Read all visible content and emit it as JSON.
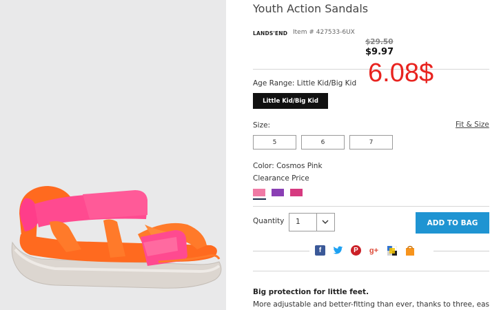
{
  "product": {
    "title": "Youth Action Sandals",
    "brand": "LANDS'END",
    "item_number": "Item # 427533-6UX",
    "price_original": "$29.50",
    "price_sale": "$9.97",
    "annotation": "6.08$"
  },
  "age_range": {
    "label": "Age Range: Little Kid/Big Kid",
    "selected": "Little Kid/Big Kid"
  },
  "size": {
    "label": "Size:",
    "fit_link": "Fit & Size",
    "options": [
      "5",
      "6",
      "7"
    ]
  },
  "color": {
    "label": "Color: Cosmos Pink",
    "price_note": "Clearance Price",
    "swatches": [
      "#f07aa5",
      "#8a3fb4",
      "#d63a80"
    ]
  },
  "quantity": {
    "label": "Quantity",
    "value": "1"
  },
  "add_to_bag": "ADD TO BAG",
  "share_icons": [
    "facebook-icon",
    "twitter-icon",
    "pinterest-icon",
    "google-plus-icon",
    "delicious-icon",
    "gift-bag-icon"
  ],
  "description": {
    "heading": "Big protection for little feet.",
    "body": "More adjustable and better-fitting than ever, thanks to three, easily"
  }
}
